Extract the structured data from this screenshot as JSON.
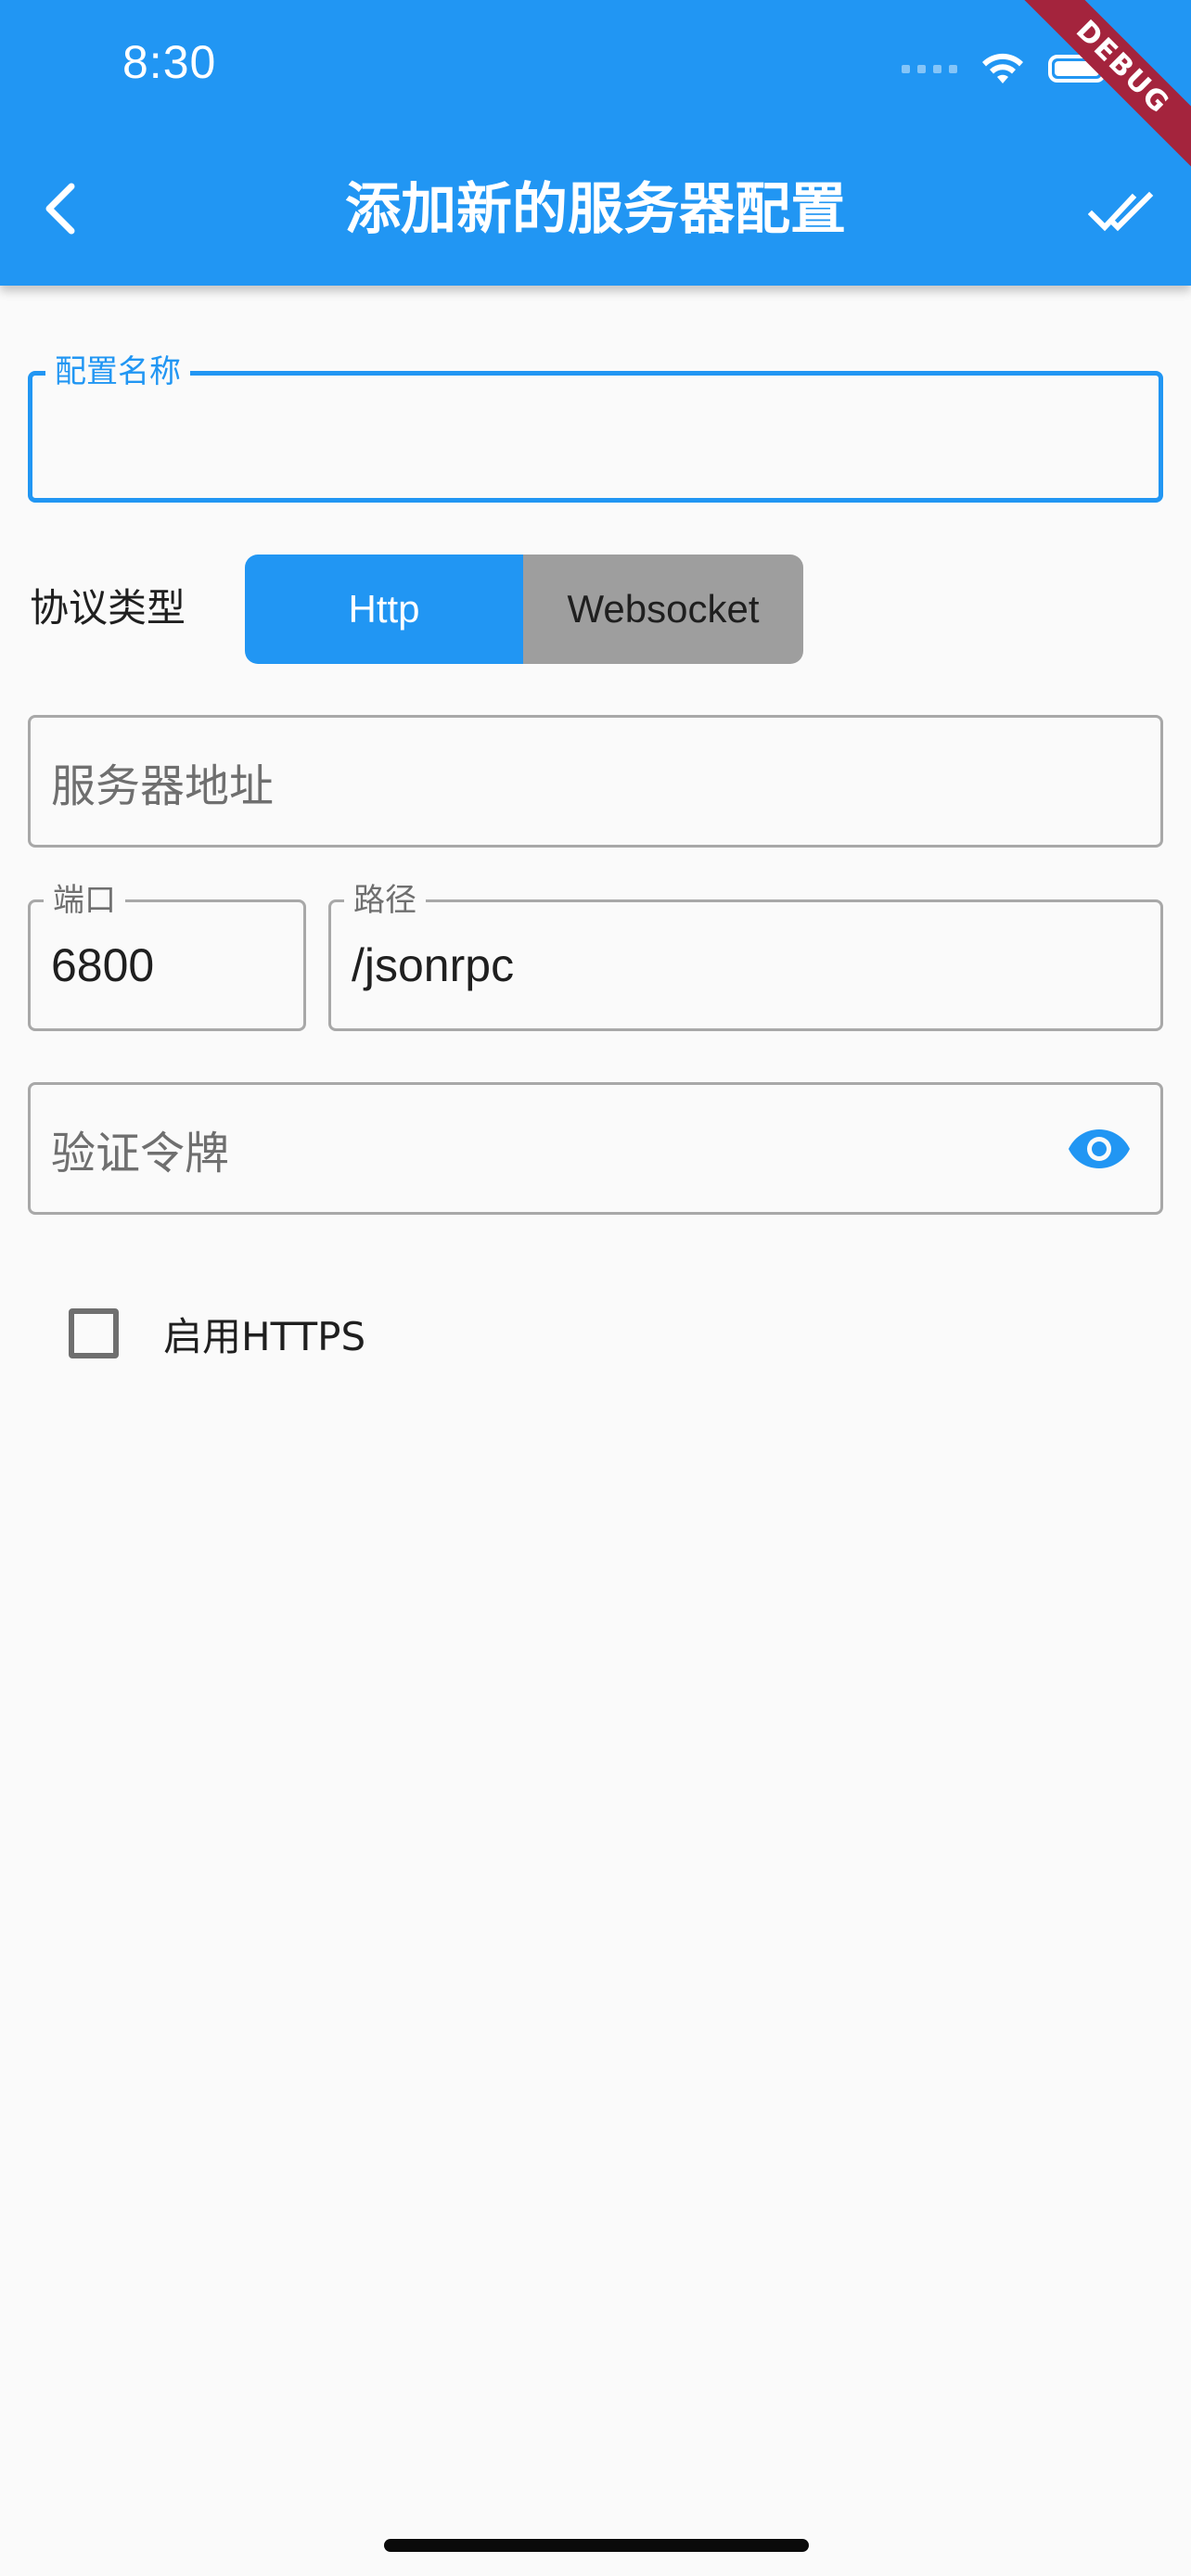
{
  "status_bar": {
    "time": "8:30"
  },
  "app_bar": {
    "title": "添加新的服务器配置",
    "back_icon": "chevron-left-icon",
    "confirm_icon": "done-all-icon",
    "background_color": "#2196f3"
  },
  "debug_banner": {
    "label": "DEBUG",
    "color": "#a4243d"
  },
  "form": {
    "config_name": {
      "label": "配置名称",
      "value": ""
    },
    "protocol": {
      "label": "协议类型",
      "options": [
        "Http",
        "Websocket"
      ],
      "selected": "Http"
    },
    "server_address": {
      "placeholder": "服务器地址",
      "value": ""
    },
    "port": {
      "label": "端口",
      "value": "6800"
    },
    "path": {
      "label": "路径",
      "value": "/jsonrpc"
    },
    "auth_token": {
      "placeholder": "验证令牌",
      "value": "",
      "visibility_icon": "eye-icon"
    },
    "enable_https": {
      "label": "启用HTTPS",
      "checked": false
    }
  },
  "colors": {
    "accent": "#2196f3",
    "inactive_segment": "#9e9e9e",
    "background": "#fafafa"
  }
}
